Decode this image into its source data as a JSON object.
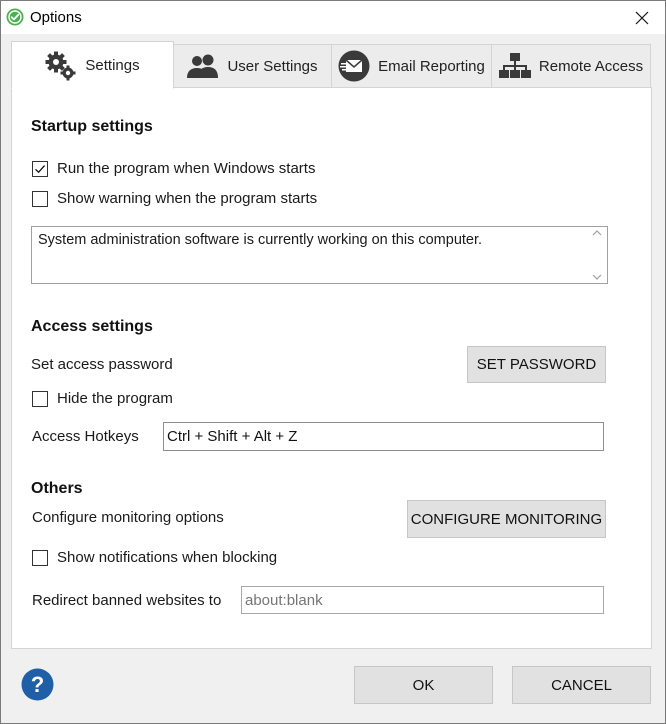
{
  "window": {
    "title": "Options"
  },
  "tabs": [
    {
      "label": "Settings",
      "icon": "gears-icon",
      "active": true
    },
    {
      "label": "User Settings",
      "icon": "users-icon",
      "active": false
    },
    {
      "label": "Email Reporting",
      "icon": "email-icon",
      "active": false
    },
    {
      "label": "Remote Access",
      "icon": "network-icon",
      "active": false
    }
  ],
  "startup": {
    "heading": "Startup settings",
    "run_on_start": {
      "label": "Run the program when Windows starts",
      "checked": true
    },
    "show_warning": {
      "label": "Show warning when the program starts",
      "checked": false
    },
    "warning_text": "System administration software is currently working on this computer."
  },
  "access": {
    "heading": "Access settings",
    "password_label": "Set access password",
    "password_button": "SET PASSWORD",
    "hide_program": {
      "label": "Hide the program",
      "checked": false
    },
    "hotkeys_label": "Access Hotkeys",
    "hotkeys_value": "Ctrl + Shift + Alt + Z"
  },
  "others": {
    "heading": "Others",
    "monitoring_label": "Configure monitoring options",
    "monitoring_button": "CONFIGURE MONITORING",
    "show_notifications": {
      "label": "Show notifications when blocking",
      "checked": false
    },
    "redirect_label": "Redirect banned websites to",
    "redirect_placeholder": "about:blank"
  },
  "footer": {
    "ok": "OK",
    "cancel": "CANCEL"
  },
  "colors": {
    "accent_green": "#4caf50",
    "help_blue": "#1e5fa8",
    "icon_dark": "#3a3a3a"
  }
}
